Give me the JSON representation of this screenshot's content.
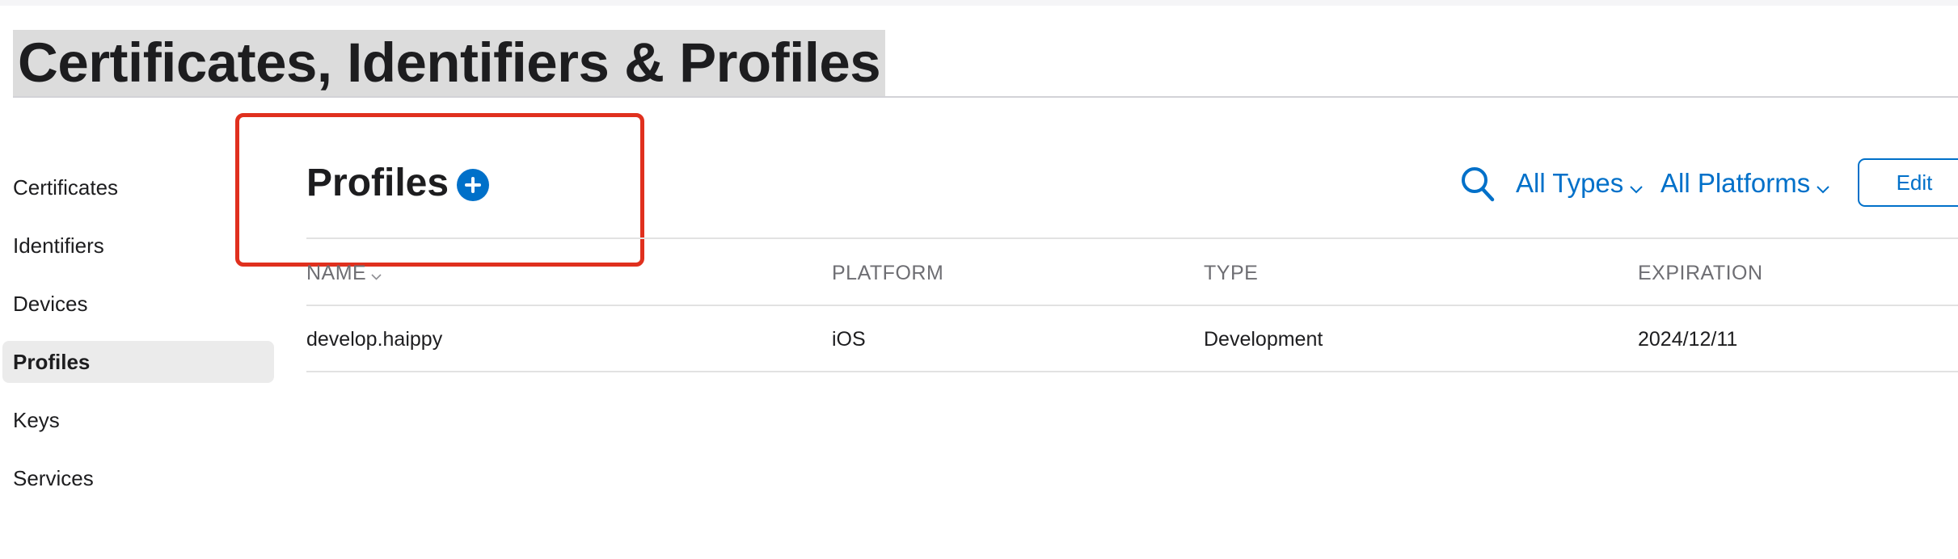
{
  "page_title": "Certificates, Identifiers & Profiles",
  "sidebar": {
    "items": [
      {
        "label": "Certificates",
        "active": false
      },
      {
        "label": "Identifiers",
        "active": false
      },
      {
        "label": "Devices",
        "active": false
      },
      {
        "label": "Profiles",
        "active": true
      },
      {
        "label": "Keys",
        "active": false
      },
      {
        "label": "Services",
        "active": false
      }
    ]
  },
  "section": {
    "title": "Profiles",
    "add_icon": "plus-circle-icon"
  },
  "toolbar": {
    "search_icon": "search-icon",
    "type_filter": "All Types",
    "platform_filter": "All Platforms",
    "edit_label": "Edit"
  },
  "table": {
    "columns": [
      "NAME",
      "PLATFORM",
      "TYPE",
      "EXPIRATION"
    ],
    "rows": [
      [
        "develop.haippy",
        "iOS",
        "Development",
        "2024/12/11"
      ]
    ]
  },
  "colors": {
    "accent": "#0070c9",
    "highlight_border": "#e0301e",
    "title_highlight": "#dcdcdc",
    "active_item_bg": "#ebebeb"
  }
}
